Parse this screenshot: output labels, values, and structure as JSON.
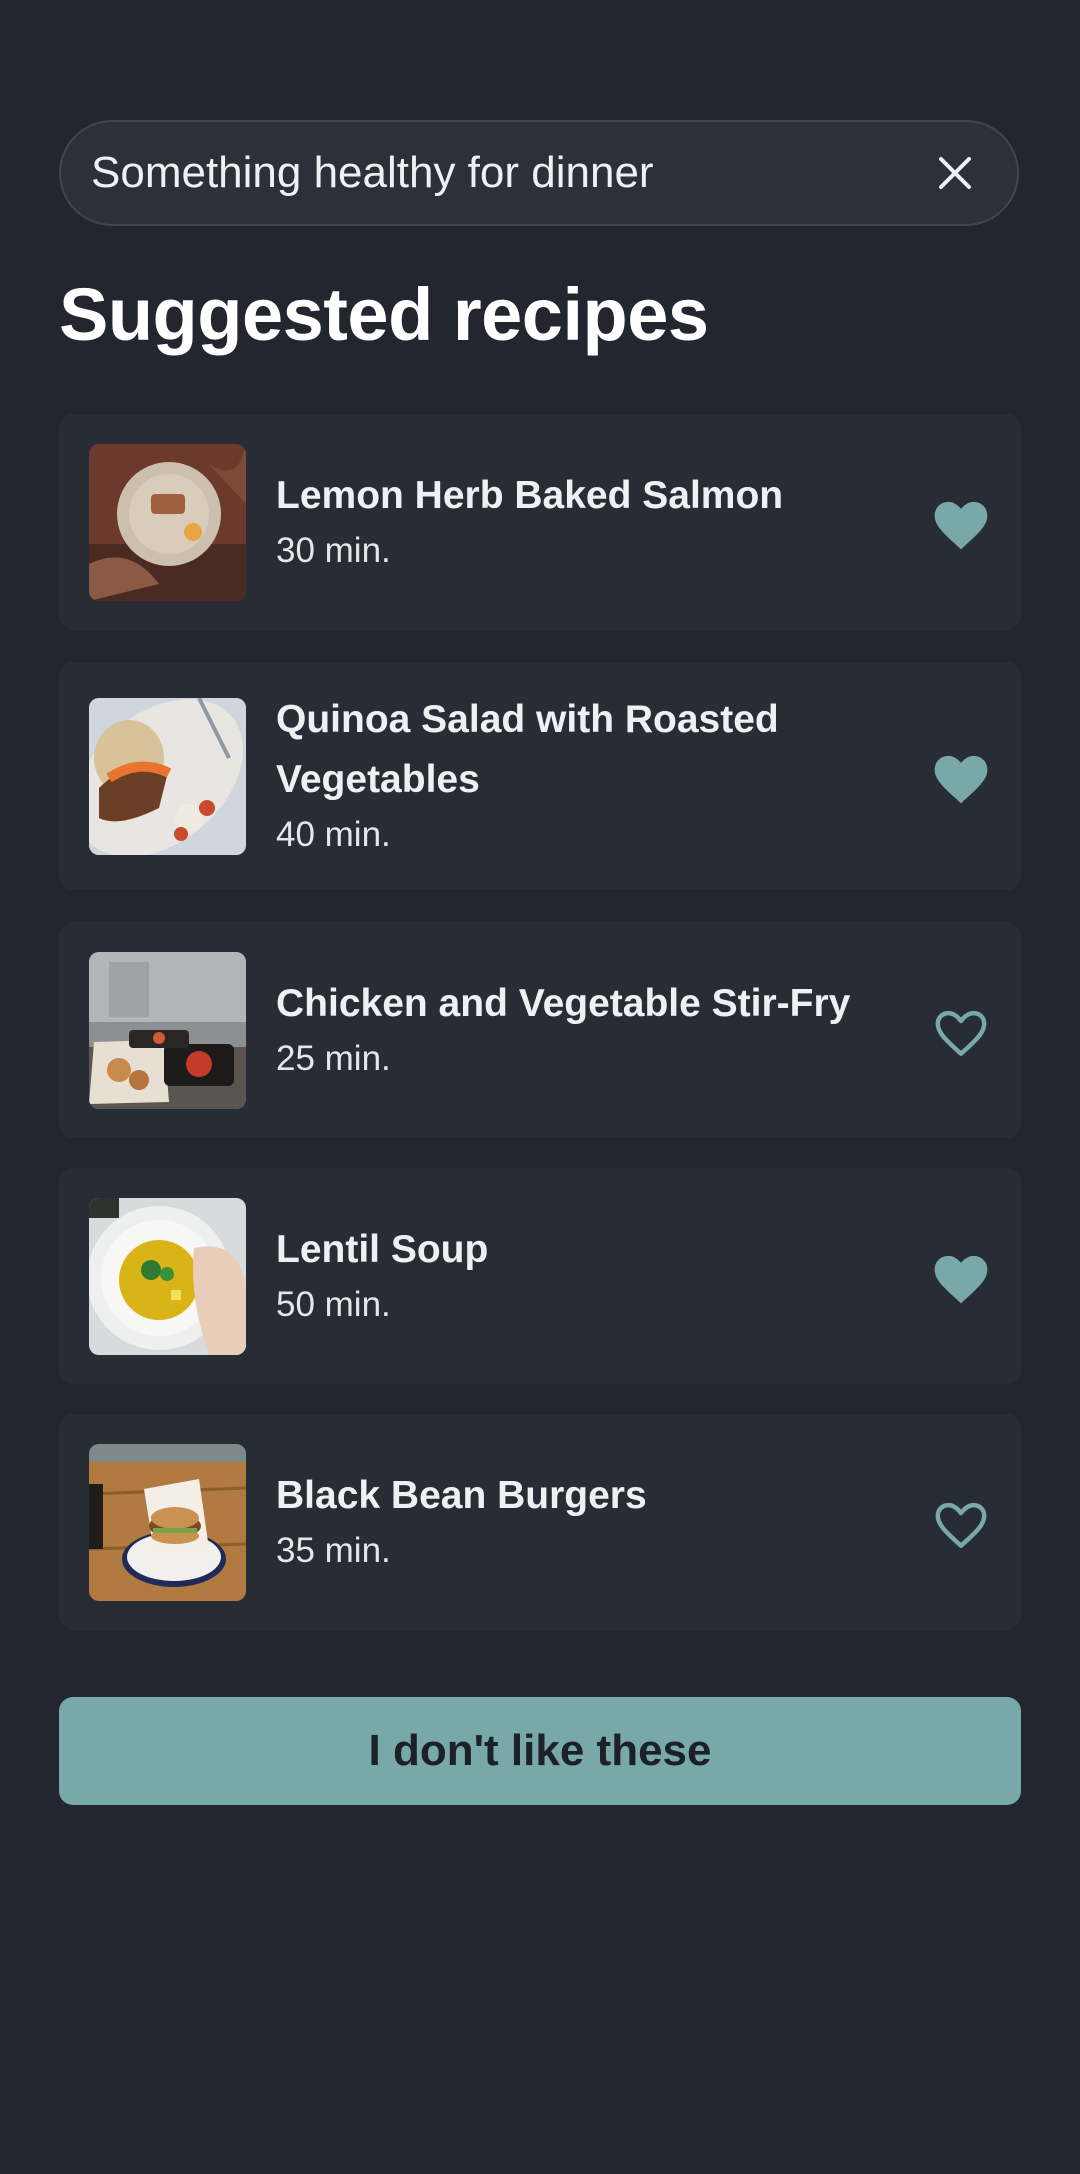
{
  "search": {
    "query": "Something healthy for dinner",
    "clear_icon": "close-icon"
  },
  "page_title": "Suggested recipes",
  "accent_color": "#78a8a8",
  "recipes": [
    {
      "name": "Lemon Herb Baked Salmon",
      "time": "30 min.",
      "favorited": true,
      "image": "salmon-plate-photo"
    },
    {
      "name": "Quinoa Salad with Roasted Vegetables",
      "time": "40 min.",
      "favorited": true,
      "image": "quinoa-salad-photo"
    },
    {
      "name": "Chicken and Vegetable Stir-Fry",
      "time": "25 min.",
      "favorited": false,
      "image": "stir-fry-containers-photo"
    },
    {
      "name": "Lentil Soup",
      "time": "50 min.",
      "favorited": true,
      "image": "lentil-soup-bowl-photo"
    },
    {
      "name": "Black Bean Burgers",
      "time": "35 min.",
      "favorited": false,
      "image": "burger-plate-photo"
    }
  ],
  "dislike_button": "I don't like these"
}
